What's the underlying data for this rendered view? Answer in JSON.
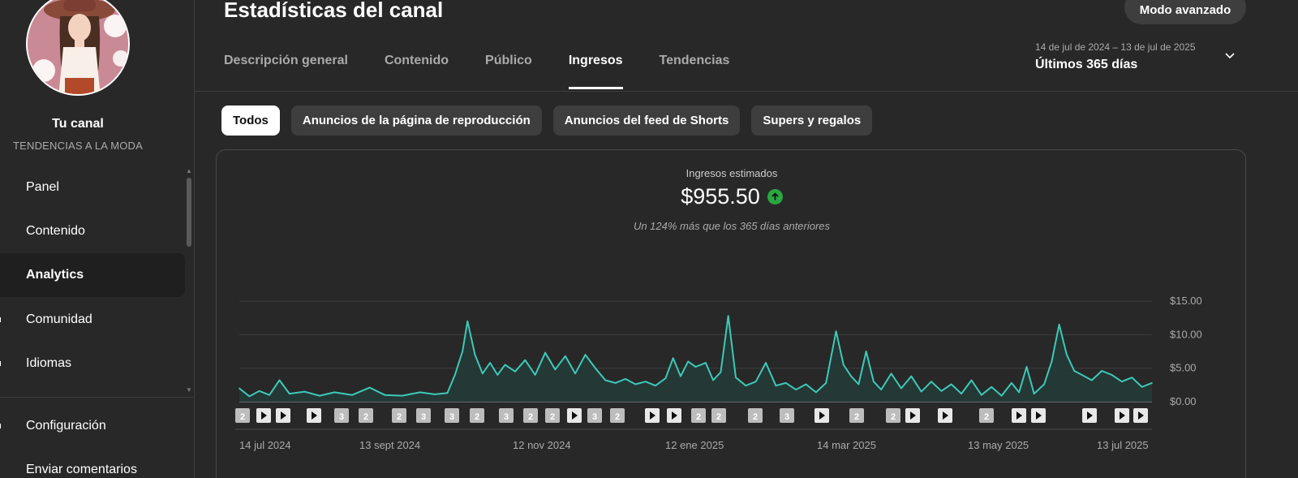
{
  "sidebar": {
    "channel_name": "Tu canal",
    "channel_subtitle": "TENDENCIAS A LA MODA",
    "items": [
      {
        "label": "Panel"
      },
      {
        "label": "Contenido"
      },
      {
        "label": "Analytics"
      },
      {
        "label": "Comunidad"
      },
      {
        "label": "Idiomas"
      }
    ],
    "bottom_items": [
      {
        "label": "Configuración"
      },
      {
        "label": "Enviar comentarios"
      }
    ]
  },
  "header": {
    "title": "Estadísticas del canal",
    "advanced_button": "Modo avanzado",
    "tabs": [
      {
        "label": "Descripción general"
      },
      {
        "label": "Contenido"
      },
      {
        "label": "Público"
      },
      {
        "label": "Ingresos"
      },
      {
        "label": "Tendencias"
      }
    ],
    "active_tab": "Ingresos",
    "date_range_small": "14 de jul de 2024 – 13 de jul de 2025",
    "date_range_main": "Últimos 365 días"
  },
  "chips": [
    {
      "label": "Todos"
    },
    {
      "label": "Anuncios de la página de reproducción"
    },
    {
      "label": "Anuncios del feed de Shorts"
    },
    {
      "label": "Supers y regalos"
    }
  ],
  "active_chip": "Todos",
  "metric": {
    "label": "Ingresos estimados",
    "value": "$955.50",
    "comparison": "Un 124% más que los 365 días anteriores"
  },
  "colors": {
    "line": "#3ec9b8",
    "area": "#233a37",
    "up_badge": "#2ba640"
  },
  "chart_data": {
    "type": "area",
    "y_ticks": [
      "$15.00",
      "$10.00",
      "$5.00",
      "$0.00"
    ],
    "ylim": [
      0,
      15
    ],
    "x_ticks": [
      "14 jul 2024",
      "13 sept 2024",
      "12 nov 2024",
      "12 ene 2025",
      "14 mar 2025",
      "13 may 2025",
      "13 jul 2025"
    ],
    "peaks": [
      {
        "day": 0,
        "value": 2.0
      },
      {
        "day": 4,
        "value": 0.8
      },
      {
        "day": 8,
        "value": 1.6
      },
      {
        "day": 12,
        "value": 1.0
      },
      {
        "day": 16,
        "value": 3.2
      },
      {
        "day": 20,
        "value": 1.2
      },
      {
        "day": 26,
        "value": 1.5
      },
      {
        "day": 32,
        "value": 0.9
      },
      {
        "day": 38,
        "value": 1.4
      },
      {
        "day": 45,
        "value": 1.0
      },
      {
        "day": 52,
        "value": 2.1
      },
      {
        "day": 58,
        "value": 1.0
      },
      {
        "day": 65,
        "value": 0.9
      },
      {
        "day": 72,
        "value": 1.4
      },
      {
        "day": 78,
        "value": 1.1
      },
      {
        "day": 83,
        "value": 1.3
      },
      {
        "day": 86,
        "value": 4.0
      },
      {
        "day": 89,
        "value": 7.5
      },
      {
        "day": 91,
        "value": 12.0
      },
      {
        "day": 94,
        "value": 7.0
      },
      {
        "day": 97,
        "value": 4.2
      },
      {
        "day": 100,
        "value": 5.8
      },
      {
        "day": 103,
        "value": 4.0
      },
      {
        "day": 106,
        "value": 5.5
      },
      {
        "day": 110,
        "value": 4.5
      },
      {
        "day": 114,
        "value": 6.2
      },
      {
        "day": 118,
        "value": 4.0
      },
      {
        "day": 122,
        "value": 7.3
      },
      {
        "day": 126,
        "value": 4.8
      },
      {
        "day": 130,
        "value": 6.8
      },
      {
        "day": 134,
        "value": 4.2
      },
      {
        "day": 138,
        "value": 7.0
      },
      {
        "day": 142,
        "value": 5.0
      },
      {
        "day": 146,
        "value": 3.2
      },
      {
        "day": 150,
        "value": 2.8
      },
      {
        "day": 154,
        "value": 3.4
      },
      {
        "day": 158,
        "value": 2.6
      },
      {
        "day": 162,
        "value": 3.0
      },
      {
        "day": 166,
        "value": 2.4
      },
      {
        "day": 170,
        "value": 3.5
      },
      {
        "day": 173,
        "value": 6.5
      },
      {
        "day": 176,
        "value": 3.8
      },
      {
        "day": 179,
        "value": 6.0
      },
      {
        "day": 182,
        "value": 5.2
      },
      {
        "day": 186,
        "value": 5.8
      },
      {
        "day": 189,
        "value": 3.2
      },
      {
        "day": 192,
        "value": 4.4
      },
      {
        "day": 195,
        "value": 12.8
      },
      {
        "day": 198,
        "value": 3.6
      },
      {
        "day": 202,
        "value": 2.4
      },
      {
        "day": 206,
        "value": 3.0
      },
      {
        "day": 210,
        "value": 5.8
      },
      {
        "day": 214,
        "value": 2.4
      },
      {
        "day": 218,
        "value": 2.8
      },
      {
        "day": 222,
        "value": 1.8
      },
      {
        "day": 226,
        "value": 2.6
      },
      {
        "day": 230,
        "value": 1.4
      },
      {
        "day": 234,
        "value": 2.8
      },
      {
        "day": 238,
        "value": 10.5
      },
      {
        "day": 241,
        "value": 5.5
      },
      {
        "day": 244,
        "value": 3.8
      },
      {
        "day": 247,
        "value": 2.6
      },
      {
        "day": 250,
        "value": 7.5
      },
      {
        "day": 253,
        "value": 3.0
      },
      {
        "day": 256,
        "value": 1.8
      },
      {
        "day": 260,
        "value": 4.2
      },
      {
        "day": 264,
        "value": 2.0
      },
      {
        "day": 268,
        "value": 3.8
      },
      {
        "day": 272,
        "value": 1.5
      },
      {
        "day": 276,
        "value": 3.0
      },
      {
        "day": 280,
        "value": 1.6
      },
      {
        "day": 284,
        "value": 2.6
      },
      {
        "day": 288,
        "value": 1.2
      },
      {
        "day": 292,
        "value": 3.2
      },
      {
        "day": 296,
        "value": 1.0
      },
      {
        "day": 300,
        "value": 2.2
      },
      {
        "day": 304,
        "value": 0.9
      },
      {
        "day": 308,
        "value": 2.8
      },
      {
        "day": 311,
        "value": 1.4
      },
      {
        "day": 314,
        "value": 5.2
      },
      {
        "day": 317,
        "value": 1.2
      },
      {
        "day": 321,
        "value": 2.6
      },
      {
        "day": 324,
        "value": 6.0
      },
      {
        "day": 327,
        "value": 11.5
      },
      {
        "day": 330,
        "value": 7.0
      },
      {
        "day": 333,
        "value": 4.6
      },
      {
        "day": 336,
        "value": 4.0
      },
      {
        "day": 340,
        "value": 3.2
      },
      {
        "day": 344,
        "value": 4.6
      },
      {
        "day": 348,
        "value": 4.0
      },
      {
        "day": 352,
        "value": 3.0
      },
      {
        "day": 356,
        "value": 3.6
      },
      {
        "day": 360,
        "value": 2.2
      },
      {
        "day": 364,
        "value": 2.8
      }
    ],
    "markers": [
      {
        "label": "2"
      },
      {
        "label": "▶"
      },
      {
        "label": "▶"
      },
      {
        "label": "▶"
      },
      {
        "label": "3"
      },
      {
        "label": "2"
      },
      {
        "label": "2"
      },
      {
        "label": "3"
      },
      {
        "label": "3"
      },
      {
        "label": "2"
      },
      {
        "label": "3"
      },
      {
        "label": "2"
      },
      {
        "label": "2"
      },
      {
        "label": "▶"
      },
      {
        "label": "3"
      },
      {
        "label": "2"
      },
      {
        "label": "▶"
      },
      {
        "label": "▶"
      },
      {
        "label": "2"
      },
      {
        "label": "2"
      },
      {
        "label": "2"
      },
      {
        "label": "3"
      },
      {
        "label": "▶"
      },
      {
        "label": "2"
      },
      {
        "label": "2"
      },
      {
        "label": "▶"
      },
      {
        "label": "▶"
      },
      {
        "label": "2"
      },
      {
        "label": "▶"
      },
      {
        "label": "▶"
      },
      {
        "label": "▶"
      },
      {
        "label": "▶"
      },
      {
        "label": "▶"
      }
    ]
  }
}
